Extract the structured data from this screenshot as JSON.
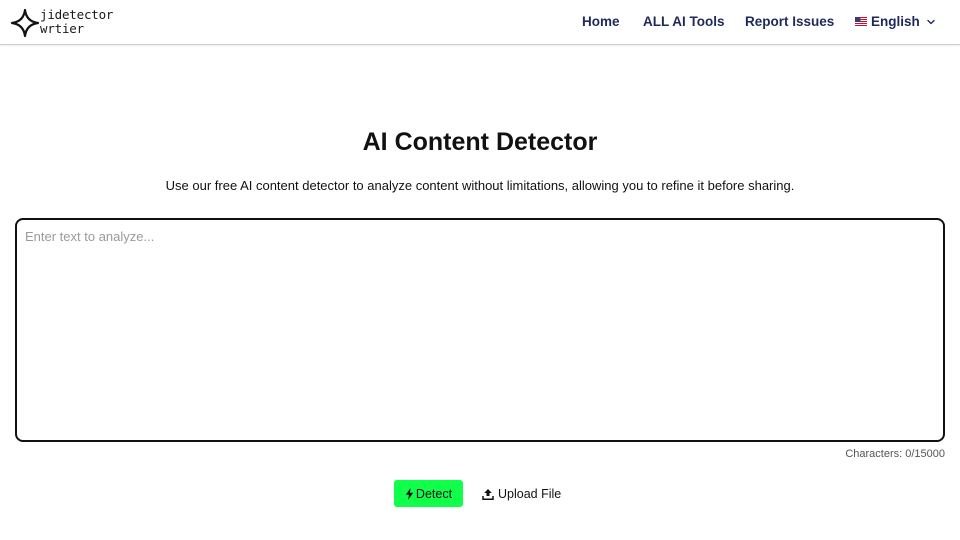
{
  "header": {
    "logo": {
      "line1": "jidetector",
      "line2": "wrtier"
    },
    "nav": {
      "home": "Home",
      "all_tools": "ALL AI Tools",
      "report": "Report Issues",
      "language": "English"
    }
  },
  "main": {
    "title": "AI Content Detector",
    "subtitle": "Use our free AI content detector to analyze content without limitations, allowing you to refine it before sharing.",
    "input": {
      "placeholder": "Enter text to analyze...",
      "value": ""
    },
    "char_count": "Characters: 0/15000",
    "detect_label": "Detect",
    "upload_label": "Upload File"
  },
  "colors": {
    "nav_text": "#1f2a5c",
    "detect_button": "#10ff4a",
    "border": "#111111"
  },
  "icons": {
    "logo": "four-point-star-icon",
    "language": "us-flag-icon",
    "dropdown": "chevron-down-icon",
    "detect": "lightning-bolt-icon",
    "upload": "upload-icon"
  }
}
